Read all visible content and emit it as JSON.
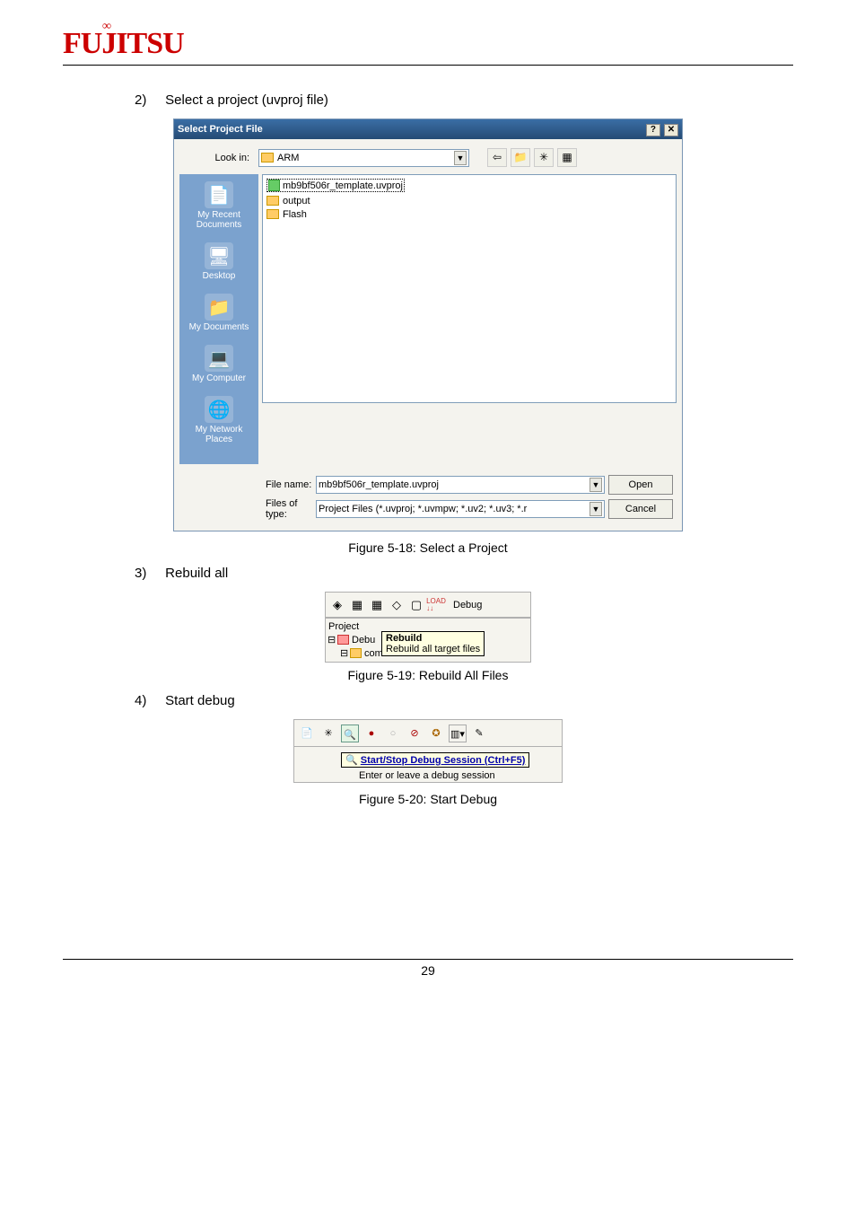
{
  "logo_text": "FUJITSU",
  "steps": [
    {
      "num": "2)",
      "text": "Select a project (uvproj file)"
    },
    {
      "num": "3)",
      "text": "Rebuild all"
    },
    {
      "num": "4)",
      "text": "Start debug"
    }
  ],
  "dialog": {
    "title": "Select Project File",
    "help_btn": "?",
    "close_btn": "✕",
    "lookin_label": "Look in:",
    "lookin_value": "ARM",
    "toolbar": {
      "back": "⇦",
      "up": "📁",
      "new": "✳",
      "view": "▦"
    },
    "files": [
      {
        "name": "mb9bf506r_template.uvproj",
        "type": "proj",
        "selected": true
      },
      {
        "name": "output",
        "type": "folder"
      },
      {
        "name": "Flash",
        "type": "folder"
      }
    ],
    "places": [
      {
        "icon": "📄",
        "label": "My Recent Documents"
      },
      {
        "icon": "🖥",
        "label": "Desktop"
      },
      {
        "icon": "📁",
        "label": "My Documents"
      },
      {
        "icon": "💻",
        "label": "My Computer"
      },
      {
        "icon": "🌐",
        "label": "My Network Places"
      }
    ],
    "filename_label": "File name:",
    "filename_value": "mb9bf506r_template.uvproj",
    "filetype_label": "Files of type:",
    "filetype_value": "Project Files (*.uvproj; *.uvmpw; *.uv2; *.uv3; *.r",
    "open_btn": "Open",
    "cancel_btn": "Cancel"
  },
  "captions": {
    "fig1": "Figure 5-18: Select a Project",
    "fig2": "Figure 5-19: Rebuild All Files",
    "fig3": "Figure 5-20: Start Debug"
  },
  "rebuild_snip": {
    "config": "Debug",
    "panel_title": "Project",
    "tooltip_title": "Rebuild",
    "tooltip_sub": "Rebuild all target files",
    "tree_item1": "Debu",
    "tree_item2": "common"
  },
  "debug_snip": {
    "tooltip_title": "Start/Stop Debug Session (Ctrl+F5)",
    "tooltip_sub": "Enter or leave a debug session"
  },
  "page_number": "29"
}
